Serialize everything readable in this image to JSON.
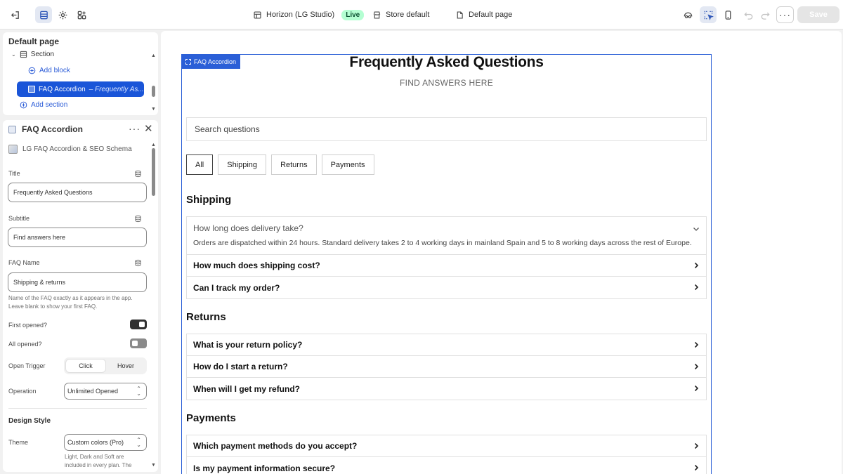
{
  "topbar": {
    "theme_name": "Horizon (LG Studio)",
    "live_badge": "Live",
    "store_label": "Store default",
    "page_label": "Default page",
    "save_label": "Save"
  },
  "tree": {
    "title": "Default page",
    "section_label": "Section",
    "add_block_label": "Add block",
    "selected_block_name": "FAQ Accordion",
    "selected_block_sub": "– Frequently As...",
    "add_section_label": "Add section"
  },
  "settings": {
    "header_title": "FAQ Accordion",
    "app_name": "LG FAQ Accordion & SEO Schema",
    "title_label": "Title",
    "title_value": "Frequently Asked Questions",
    "subtitle_label": "Subtitle",
    "subtitle_value": "Find answers here",
    "faq_name_label": "FAQ Name",
    "faq_name_value": "Shipping & returns",
    "faq_name_help_1": "Name of the FAQ exactly as it appears in the app.",
    "faq_name_help_2": "Leave blank to show your first FAQ.",
    "first_opened_label": "First opened?",
    "first_opened": true,
    "all_opened_label": "All opened?",
    "all_opened": false,
    "open_trigger_label": "Open Trigger",
    "trigger_options": [
      "Click",
      "Hover"
    ],
    "trigger_selected": "Click",
    "operation_label": "Operation",
    "operation_value": "Unlimited Opened",
    "design_style_label": "Design Style",
    "theme_label": "Theme",
    "theme_value": "Custom colors (Pro)",
    "theme_help_1": "Light, Dark and Soft are",
    "theme_help_2": "included in every plan. The"
  },
  "preview": {
    "selection_tag": "FAQ Accordion",
    "title": "Frequently Asked Questions",
    "subtitle": "FIND ANSWERS HERE",
    "search_placeholder": "Search questions",
    "filters": [
      "All",
      "Shipping",
      "Returns",
      "Payments"
    ],
    "active_filter": "All",
    "categories": [
      {
        "name": "Shipping",
        "questions": [
          {
            "q": "How long does delivery take?",
            "a": "Orders are dispatched within 24 hours. Standard delivery takes 2 to 4 working days in mainland Spain and 5 to 8 working days across the rest of Europe.",
            "open": true
          },
          {
            "q": "How much does shipping cost?"
          },
          {
            "q": "Can I track my order?"
          }
        ]
      },
      {
        "name": "Returns",
        "questions": [
          {
            "q": "What is your return policy?"
          },
          {
            "q": "How do I start a return?"
          },
          {
            "q": "When will I get my refund?"
          }
        ]
      },
      {
        "name": "Payments",
        "questions": [
          {
            "q": "Which payment methods do you accept?"
          },
          {
            "q": "Is my payment information secure?"
          }
        ]
      }
    ]
  },
  "colors": {
    "accent": "#2b5fd7",
    "live_bg": "#b4fed2",
    "selected_block_bg": "#1a55d8"
  },
  "icons": [
    "exit-icon",
    "sections-icon",
    "gear-icon",
    "apps-icon",
    "theme-icon",
    "store-icon",
    "page-icon",
    "inspector-icon",
    "select-icon",
    "mobile-icon",
    "undo-icon",
    "redo-icon"
  ]
}
